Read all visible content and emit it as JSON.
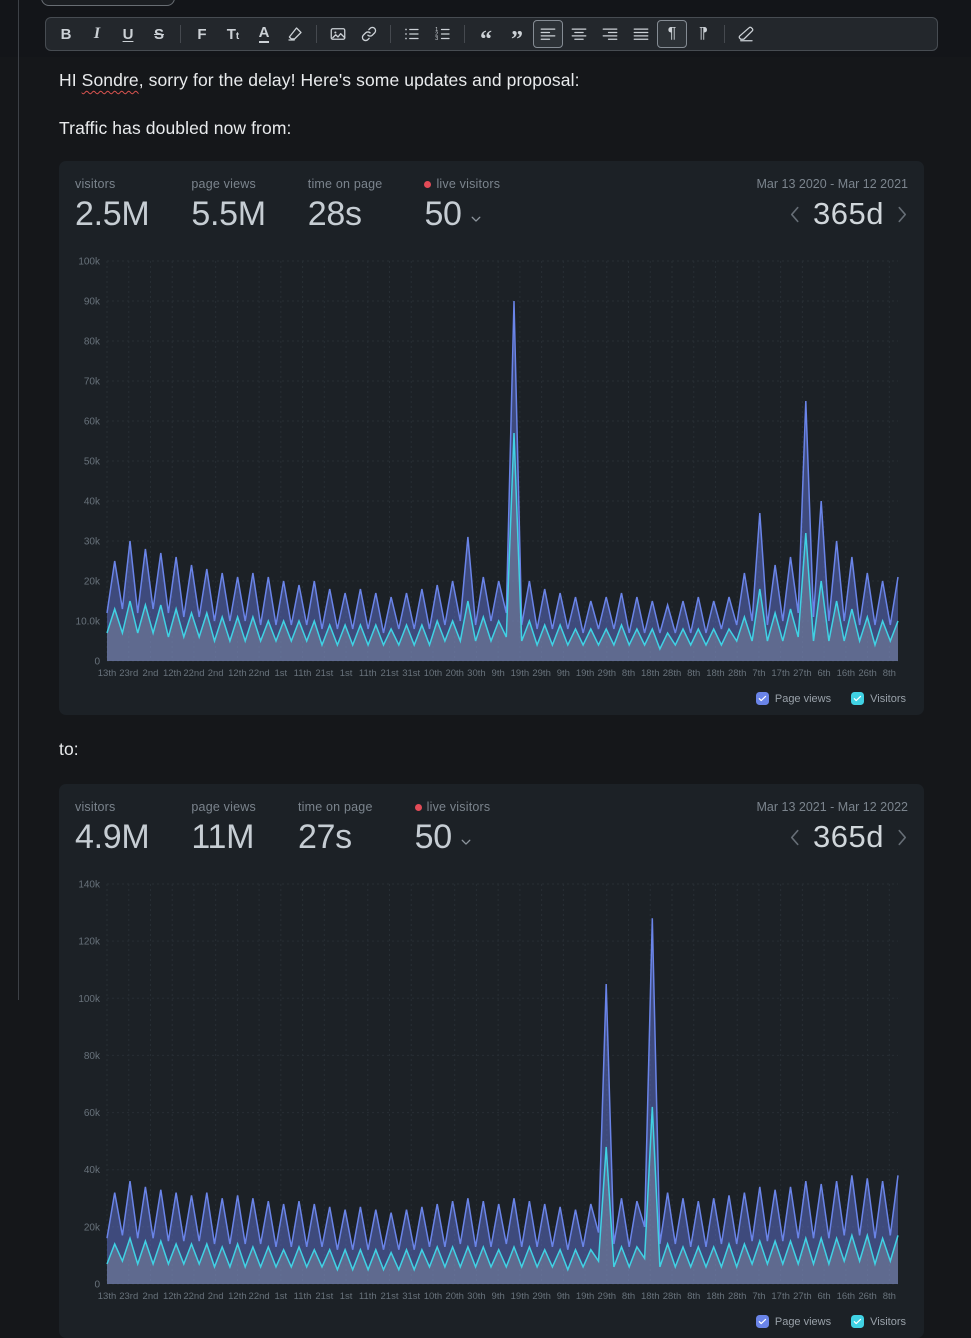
{
  "toolbar": {
    "items": [
      {
        "kind": "button",
        "name": "bold",
        "icon": "bold",
        "label": "B"
      },
      {
        "kind": "button",
        "name": "italic",
        "icon": "italic",
        "label": "I"
      },
      {
        "kind": "button",
        "name": "underline",
        "icon": "underline",
        "label": "U"
      },
      {
        "kind": "button",
        "name": "strikethrough",
        "icon": "strikethrough",
        "label": "S"
      },
      {
        "kind": "separator"
      },
      {
        "kind": "button",
        "name": "font",
        "icon": "font",
        "label": "F"
      },
      {
        "kind": "button",
        "name": "text-size",
        "icon": "text-size",
        "label": "Tt"
      },
      {
        "kind": "button",
        "name": "text-color",
        "icon": "text-color",
        "label": "A"
      },
      {
        "kind": "button",
        "name": "highlight",
        "icon": "highlighter"
      },
      {
        "kind": "separator"
      },
      {
        "kind": "button",
        "name": "insert-image",
        "icon": "image"
      },
      {
        "kind": "button",
        "name": "insert-link",
        "icon": "link"
      },
      {
        "kind": "separator"
      },
      {
        "kind": "button",
        "name": "bullet-list",
        "icon": "list-ul"
      },
      {
        "kind": "button",
        "name": "ordered-list",
        "icon": "list-ol"
      },
      {
        "kind": "separator"
      },
      {
        "kind": "button",
        "name": "quote-open",
        "icon": "quote-open",
        "label": "“"
      },
      {
        "kind": "button",
        "name": "quote-close",
        "icon": "quote-close",
        "label": "”"
      },
      {
        "kind": "button",
        "name": "align-left",
        "icon": "align-left",
        "active": true
      },
      {
        "kind": "button",
        "name": "align-center",
        "icon": "align-center"
      },
      {
        "kind": "button",
        "name": "align-right",
        "icon": "align-right"
      },
      {
        "kind": "button",
        "name": "align-justify",
        "icon": "align-justify"
      },
      {
        "kind": "button",
        "name": "direction-ltr",
        "icon": "pilcrow-ltr",
        "label": "¶",
        "active": true
      },
      {
        "kind": "button",
        "name": "direction-rtl",
        "icon": "pilcrow-rtl",
        "label": "¶"
      },
      {
        "kind": "separator"
      },
      {
        "kind": "button",
        "name": "clear-formatting",
        "icon": "eraser"
      }
    ]
  },
  "editor": {
    "greeting_prefix": "HI ",
    "misspelled_word": "Sondre",
    "greeting_suffix": ", sorry for the delay! Here's some updates and proposal:",
    "line2": "Traffic has doubled now from:",
    "line3": "to:"
  },
  "cards": [
    {
      "stats": [
        {
          "label": "visitors",
          "value": "2.5M"
        },
        {
          "label": "page views",
          "value": "5.5M"
        },
        {
          "label": "time on page",
          "value": "28s"
        },
        {
          "label": "live visitors",
          "value": "50",
          "live": true
        }
      ],
      "date_range": "Mar 13 2020 - Mar 12 2021",
      "period": "365d",
      "chart_data": {
        "type": "area",
        "unit": "k",
        "ylim": [
          0,
          100
        ],
        "ytick_step": 10,
        "ytick_labels": [
          "0",
          "10.0k",
          "20k",
          "30k",
          "40k",
          "50k",
          "60k",
          "70k",
          "80k",
          "90k",
          "100k"
        ],
        "xtick_interval_days": 10,
        "total_days": 364,
        "grid_color": "#272e34",
        "axis_label_color": "#68727b",
        "xtick_labels": [
          "13th",
          "23rd",
          "2nd",
          "12th",
          "22nd",
          "2nd",
          "12th",
          "22nd",
          "1st",
          "11th",
          "21st",
          "1st",
          "11th",
          "21st",
          "31st",
          "10th",
          "20th",
          "30th",
          "9th",
          "19th",
          "29th",
          "9th",
          "19th",
          "29th",
          "8th",
          "18th",
          "28th",
          "8th",
          "18th",
          "28th",
          "7th",
          "17th",
          "27th",
          "6th",
          "16th",
          "26th",
          "8th"
        ],
        "legend_position": "bottom-right",
        "series": [
          {
            "name": "Page views",
            "color": "#6a84e8",
            "fill": "rgba(96,115,210,0.5)",
            "values": [
              12,
              25,
              13,
              30,
              12,
              28,
              13,
              27,
              12,
              26,
              11,
              24,
              11,
              23,
              10,
              22,
              10,
              21,
              10,
              22,
              9,
              21,
              9,
              20,
              9,
              19,
              9,
              20,
              8,
              18,
              8,
              17,
              8,
              18,
              8,
              17,
              7,
              16,
              8,
              17,
              8,
              18,
              8,
              19,
              9,
              20,
              10,
              31,
              9,
              21,
              10,
              20,
              12,
              90,
              9,
              20,
              8,
              18,
              8,
              17,
              8,
              16,
              7,
              15,
              8,
              16,
              8,
              17,
              7,
              16,
              7,
              15,
              7,
              14,
              7,
              15,
              7,
              16,
              7,
              15,
              8,
              16,
              9,
              22,
              10,
              37,
              9,
              24,
              10,
              26,
              12,
              65,
              11,
              40,
              10,
              30,
              10,
              26,
              9,
              22,
              9,
              20,
              9,
              21
            ]
          },
          {
            "name": "Visitors",
            "color": "#40d2e4",
            "fill": "rgba(165,175,185,0.32)",
            "values": [
              7,
              13,
              7,
              15,
              7,
              14,
              7,
              14,
              6,
              13,
              6,
              12,
              6,
              12,
              5,
              11,
              5,
              11,
              5,
              11,
              5,
              10,
              5,
              10,
              5,
              10,
              5,
              10,
              4,
              9,
              4,
              9,
              4,
              9,
              4,
              9,
              4,
              8,
              4,
              9,
              4,
              9,
              4,
              10,
              5,
              10,
              5,
              15,
              5,
              11,
              5,
              10,
              6,
              57,
              5,
              10,
              4,
              9,
              4,
              9,
              4,
              8,
              4,
              8,
              4,
              8,
              4,
              9,
              4,
              8,
              4,
              8,
              3,
              7,
              4,
              8,
              4,
              8,
              4,
              8,
              4,
              8,
              5,
              11,
              5,
              18,
              5,
              12,
              5,
              13,
              6,
              32,
              5,
              20,
              5,
              15,
              5,
              13,
              5,
              11,
              4,
              10,
              5,
              10
            ]
          }
        ]
      }
    },
    {
      "stats": [
        {
          "label": "visitors",
          "value": "4.9M"
        },
        {
          "label": "page views",
          "value": "11M"
        },
        {
          "label": "time on page",
          "value": "27s"
        },
        {
          "label": "live visitors",
          "value": "50",
          "live": true
        }
      ],
      "date_range": "Mar 13 2021 - Mar 12 2022",
      "period": "365d",
      "chart_data": {
        "type": "area",
        "unit": "k",
        "ylim": [
          0,
          140
        ],
        "ytick_step": 20,
        "ytick_labels": [
          "0",
          "20k",
          "40k",
          "60k",
          "80k",
          "100k",
          "120k",
          "140k"
        ],
        "xtick_interval_days": 10,
        "total_days": 364,
        "grid_color": "#272e34",
        "axis_label_color": "#68727b",
        "xtick_labels": [
          "13th",
          "23rd",
          "2nd",
          "12th",
          "22nd",
          "2nd",
          "12th",
          "22nd",
          "1st",
          "11th",
          "21st",
          "1st",
          "11th",
          "21st",
          "31st",
          "10th",
          "20th",
          "30th",
          "9th",
          "19th",
          "29th",
          "9th",
          "19th",
          "29th",
          "8th",
          "18th",
          "28th",
          "8th",
          "18th",
          "28th",
          "7th",
          "17th",
          "27th",
          "6th",
          "16th",
          "26th",
          "8th"
        ],
        "legend_position": "bottom-right",
        "series": [
          {
            "name": "Page views",
            "color": "#6a84e8",
            "fill": "rgba(96,115,210,0.5)",
            "values": [
              16,
              32,
              17,
              36,
              16,
              34,
              16,
              33,
              15,
              32,
              15,
              31,
              15,
              32,
              14,
              30,
              14,
              31,
              14,
              30,
              14,
              29,
              13,
              28,
              13,
              29,
              13,
              28,
              13,
              27,
              12,
              26,
              12,
              27,
              12,
              26,
              12,
              25,
              12,
              26,
              12,
              27,
              13,
              28,
              13,
              29,
              14,
              30,
              13,
              29,
              13,
              28,
              14,
              30,
              13,
              29,
              13,
              28,
              13,
              27,
              12,
              26,
              13,
              28,
              18,
              105,
              14,
              30,
              13,
              29,
              20,
              128,
              14,
              32,
              14,
              30,
              13,
              29,
              13,
              30,
              14,
              31,
              14,
              32,
              15,
              34,
              15,
              33,
              15,
              34,
              16,
              36,
              16,
              35,
              16,
              36,
              17,
              38,
              17,
              37,
              16,
              36,
              17,
              38
            ]
          },
          {
            "name": "Visitors",
            "color": "#40d2e4",
            "fill": "rgba(165,175,185,0.32)",
            "values": [
              7,
              14,
              8,
              16,
              7,
              15,
              7,
              15,
              7,
              14,
              7,
              14,
              7,
              14,
              6,
              13,
              6,
              14,
              6,
              13,
              6,
              13,
              6,
              12,
              6,
              13,
              6,
              12,
              6,
              12,
              5,
              12,
              5,
              12,
              5,
              12,
              5,
              11,
              5,
              12,
              5,
              12,
              6,
              13,
              6,
              13,
              6,
              13,
              6,
              13,
              6,
              12,
              6,
              13,
              6,
              13,
              6,
              12,
              6,
              12,
              5,
              12,
              6,
              12,
              8,
              48,
              6,
              13,
              6,
              13,
              9,
              62,
              6,
              14,
              6,
              13,
              6,
              13,
              6,
              13,
              6,
              14,
              6,
              14,
              7,
              15,
              7,
              15,
              7,
              15,
              7,
              16,
              7,
              16,
              7,
              16,
              8,
              17,
              8,
              17,
              7,
              16,
              8,
              17
            ]
          }
        ]
      }
    }
  ]
}
